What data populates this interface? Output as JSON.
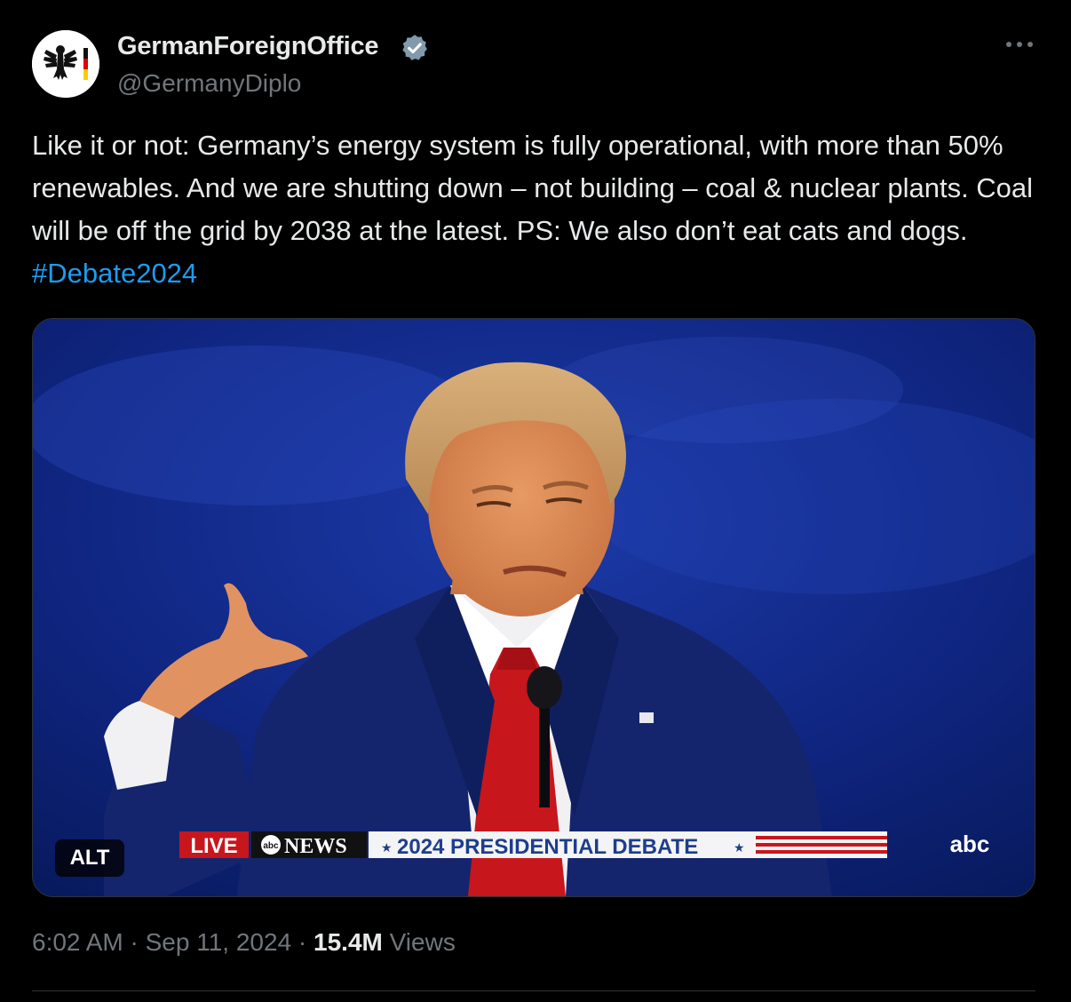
{
  "account": {
    "display_name": "GermanForeignOffice",
    "handle": "@GermanyDiplo",
    "verified_icon": "verified-badge-icon",
    "avatar_icon": "federal-eagle-logo"
  },
  "tweet": {
    "text_main": "Like it or not: Germany’s energy system is fully operational, with more than 50% renewables. And we are shutting down – not building – coal & nuclear plants. Coal will be off the grid by 2038 at the latest. PS: We also don’t eat cats and dogs.",
    "hashtag": "#Debate2024"
  },
  "media": {
    "alt_badge": "ALT",
    "chyron": {
      "live": "LIVE",
      "network_logo": "abc",
      "network": "NEWS",
      "title": "2024 PRESIDENTIAL DEBATE",
      "star": "★",
      "corner_logo": "abc"
    }
  },
  "meta": {
    "time": "6:02 AM",
    "separator": "·",
    "date": "Sep 11, 2024",
    "views_count": "15.4M",
    "views_label": "Views"
  },
  "colors": {
    "background": "#000000",
    "text": "#e7e9ea",
    "secondary": "#71767b",
    "link": "#1d9bf0",
    "border": "#2f3336"
  }
}
